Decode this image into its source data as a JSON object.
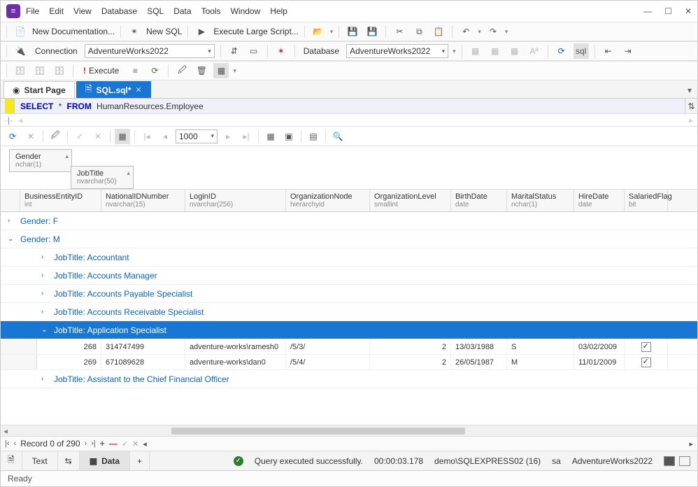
{
  "menu": [
    "File",
    "Edit",
    "View",
    "Database",
    "SQL",
    "Data",
    "Tools",
    "Window",
    "Help"
  ],
  "toolbar1": {
    "newdoc": "New Documentation...",
    "newsql": "New SQL",
    "execlarge": "Execute Large Script..."
  },
  "conn": {
    "label": "Connection",
    "value": "AdventureWorks2022",
    "dblabel": "Database",
    "dbvalue": "AdventureWorks2022"
  },
  "exec": {
    "label": "Execute"
  },
  "tabs": {
    "start": "Start Page",
    "sql": "SQL.sql*"
  },
  "query": {
    "select": "SELECT",
    "star": "*",
    "from": "FROM",
    "table": "HumanResources.Employee"
  },
  "gridtb": {
    "rows": "1000"
  },
  "groupcols": [
    {
      "name": "Gender",
      "type": "nchar(1)"
    },
    {
      "name": "JobTitle",
      "type": "nvarchar(50)"
    }
  ],
  "columns": [
    {
      "name": "BusinessEntityID",
      "type": "int"
    },
    {
      "name": "NationalIDNumber",
      "type": "nvarchar(15)"
    },
    {
      "name": "LoginID",
      "type": "nvarchar(256)"
    },
    {
      "name": "OrganizationNode",
      "type": "hierarchyid"
    },
    {
      "name": "OrganizationLevel",
      "type": "smallint"
    },
    {
      "name": "BirthDate",
      "type": "date"
    },
    {
      "name": "MaritalStatus",
      "type": "nchar(1)"
    },
    {
      "name": "HireDate",
      "type": "date"
    },
    {
      "name": "SalariedFlag",
      "type": "bit"
    }
  ],
  "groups": {
    "genderF": "Gender: F",
    "genderM": "Gender: M",
    "jt": [
      "JobTitle: Accountant",
      "JobTitle: Accounts Manager",
      "JobTitle: Accounts Payable Specialist",
      "JobTitle: Accounts Receivable Specialist",
      "JobTitle: Application Specialist",
      "JobTitle: Assistant to the Chief Financial Officer"
    ]
  },
  "rows": [
    {
      "be": "268",
      "nid": "314747499",
      "login": "adventure-works\\ramesh0",
      "org": "/5/3/",
      "lvl": "2",
      "bdate": "13/03/1988",
      "ms": "S",
      "hire": "03/02/2009",
      "sf": true
    },
    {
      "be": "269",
      "nid": "671089628",
      "login": "adventure-works\\dan0",
      "org": "/5/4/",
      "lvl": "2",
      "bdate": "26/05/1987",
      "ms": "M",
      "hire": "11/01/2009",
      "sf": true
    }
  ],
  "recnav": {
    "label": "Record 0 of 290"
  },
  "bottomtabs": {
    "text": "Text",
    "data": "Data"
  },
  "status": {
    "msg": "Query executed successfully.",
    "time": "00:00:03.178",
    "conn": "demo\\SQLEXPRESS02 (16)",
    "user": "sa",
    "db": "AdventureWorks2022",
    "ready": "Ready"
  }
}
